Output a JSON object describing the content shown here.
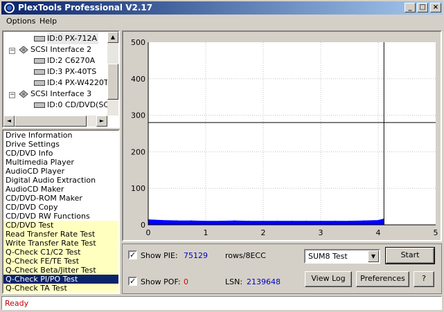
{
  "window": {
    "title": "PlexTools Professional V2.17",
    "controls": {
      "minimize": "_",
      "maximize": "□",
      "close": "×"
    }
  },
  "menu": [
    "Options",
    "Help"
  ],
  "tree": {
    "items": [
      {
        "label": "ID:0  PX-712A",
        "type": "drive",
        "selected": true
      },
      {
        "label": "SCSI Interface 2",
        "type": "interface"
      },
      {
        "label": "ID:2  C6270A",
        "type": "drive"
      },
      {
        "label": "ID:3  PX-40TS",
        "type": "drive"
      },
      {
        "label": "ID:4  PX-W4220T",
        "type": "drive"
      },
      {
        "label": "SCSI Interface 3",
        "type": "interface"
      },
      {
        "label": "ID:0  CD/DVD(SCSI)",
        "type": "drive"
      }
    ]
  },
  "functions": [
    {
      "label": "Drive Information"
    },
    {
      "label": "Drive Settings"
    },
    {
      "label": "CD/DVD Info"
    },
    {
      "label": "Multimedia Player"
    },
    {
      "label": "AudioCD Player"
    },
    {
      "label": "Digital Audio Extraction"
    },
    {
      "label": "AudioCD Maker"
    },
    {
      "label": "CD/DVD-ROM Maker"
    },
    {
      "label": "CD/DVD Copy"
    },
    {
      "label": "CD/DVD RW Functions"
    },
    {
      "label": "CD/DVD Test",
      "highlight": "yellow"
    },
    {
      "label": "Read Transfer Rate Test",
      "highlight": "yellow"
    },
    {
      "label": "Write Transfer Rate Test",
      "highlight": "yellow"
    },
    {
      "label": "Q-Check C1/C2 Test",
      "highlight": "yellow"
    },
    {
      "label": "Q-Check FE/TE Test",
      "highlight": "yellow"
    },
    {
      "label": "Q-Check Beta/Jitter Test",
      "highlight": "yellow"
    },
    {
      "label": "Q-Check PI/PO Test",
      "highlight": "selected"
    },
    {
      "label": "Q-Check TA Test",
      "highlight": "yellow"
    }
  ],
  "chart_data": {
    "type": "area",
    "title": "",
    "xlabel": "",
    "ylabel": "",
    "xlim": [
      0,
      5
    ],
    "ylim": [
      0,
      500
    ],
    "x_ticks": [
      0,
      1,
      2,
      3,
      4,
      5
    ],
    "y_ticks": [
      0,
      100,
      200,
      300,
      400,
      500
    ],
    "grid": true,
    "series": [
      {
        "color": "#0000ff",
        "x": [
          0,
          0.25,
          0.5,
          0.75,
          1,
          1.25,
          1.5,
          1.75,
          2,
          2.25,
          2.5,
          2.75,
          3,
          3.25,
          3.5,
          3.75,
          4,
          4.1
        ],
        "values": [
          14,
          12,
          11,
          11,
          10,
          10,
          11,
          10,
          10,
          10,
          10,
          10,
          10,
          10,
          10,
          11,
          12,
          16
        ]
      }
    ],
    "cursor_x": 4.1,
    "reference_y": 280,
    "colors": {
      "plot_bg": "#ffffff",
      "grid": "#c0c0c0",
      "line": "#000000"
    }
  },
  "controls": {
    "pie": {
      "label": "Show PIE:",
      "checked": true,
      "value": "75129",
      "unit": "rows/8ECC"
    },
    "pof": {
      "label": "Show POF:",
      "checked": true,
      "value": "0"
    },
    "lsn": {
      "label": "LSN:",
      "value": "2139648"
    },
    "test_select": "SUM8 Test",
    "start_button": "Start",
    "view_log_button": "View Log",
    "preferences_button": "Preferences",
    "help_button": "?"
  },
  "status": "Ready"
}
